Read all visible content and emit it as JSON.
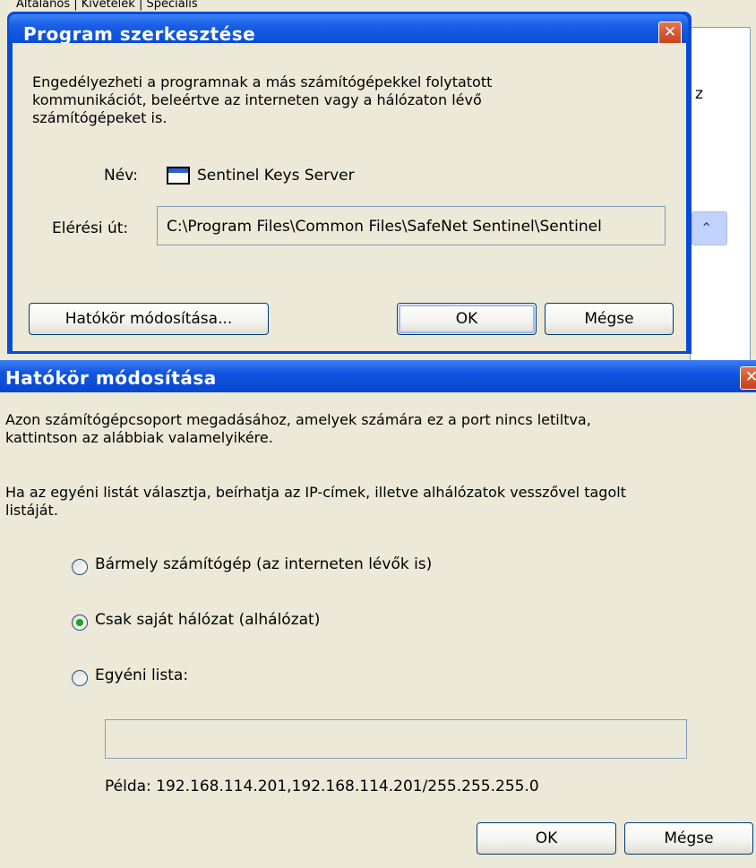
{
  "background": {
    "tabs_text": "Általános  |  Kivételek  |  Speciális",
    "partial_text": "z"
  },
  "edit_dialog": {
    "title": "Program szerkesztése",
    "description": "Engedélyezheti a programnak a más számítógépekkel folytatott\nkommunikációt, beleértve az interneten vagy a hálózaton lévő\nszámítógépeket is.",
    "name_label": "Név:",
    "name_value": "Sentinel Keys Server",
    "path_label": "Elérési út:",
    "path_value": "C:\\Program Files\\Common Files\\SafeNet Sentinel\\Sentinel",
    "scope_button": "Hatókör módosítása...",
    "ok_button": "OK",
    "cancel_button": "Mégse",
    "close_glyph": "✕"
  },
  "scope_dialog": {
    "title": "Hatókör módosítása",
    "description1": "Azon számítógépcsoport megadásához, amelyek számára ez a port nincs letiltva,\nkattintson az alábbiak valamelyikére.",
    "description2": "Ha az egyéni listát választja, beírhatja az IP-címek, illetve alhálózatok vesszővel tagolt\nlistáját.",
    "options": [
      {
        "label": "Bármely számítógép (az interneten lévők is)",
        "selected": false
      },
      {
        "label": "Csak saját hálózat (alhálózat)",
        "selected": true
      },
      {
        "label": "Egyéni lista:",
        "selected": false
      }
    ],
    "custom_list_value": "",
    "example": "Példa: 192.168.114.201,192.168.114.201/255.255.255.0",
    "ok_button": "OK",
    "cancel_button": "Mégse",
    "close_glyph": "✕"
  },
  "colors": {
    "titlebar": "#0a50d8",
    "dialog_bg": "#ece9d8",
    "radio_selected": "#21a121"
  }
}
